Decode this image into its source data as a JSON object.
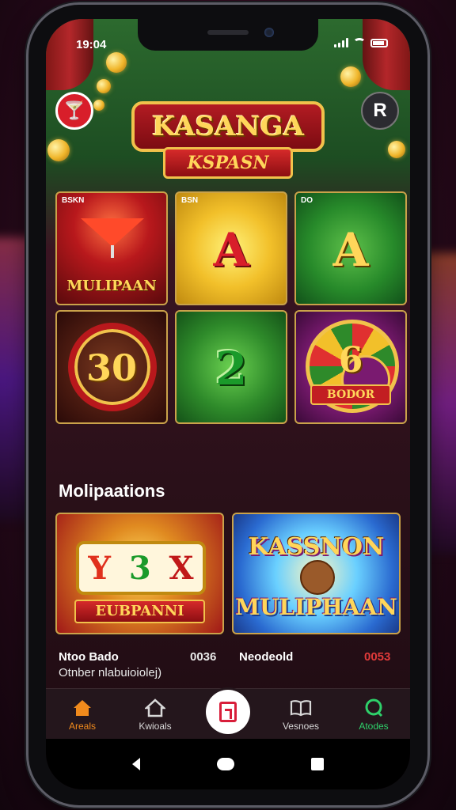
{
  "status_bar": {
    "time": "19:04"
  },
  "header": {
    "logo_title": "KASANGA",
    "logo_subtitle": "KSPASN",
    "right_button_glyph": "R",
    "left_button_icon": "cocktail-icon",
    "right_button_icon": "profile-icon"
  },
  "games": [
    {
      "tag": "BSKN",
      "big": "",
      "caption": "MULIPAAN",
      "theme": "cocktail"
    },
    {
      "tag": "BSN",
      "big": "A",
      "caption": "",
      "theme": "gold-letter"
    },
    {
      "tag": "DO",
      "big": "A",
      "caption": "",
      "theme": "green-letter"
    },
    {
      "tag": "",
      "big": "30",
      "caption": "",
      "theme": "ring"
    },
    {
      "tag": "",
      "big": "2",
      "caption": "",
      "theme": "green-number"
    },
    {
      "tag": "",
      "big": "6",
      "caption": "BODOR",
      "theme": "wheel"
    }
  ],
  "section": {
    "title": "Molipaations"
  },
  "promos": [
    {
      "reels": [
        "Y",
        "3",
        "X"
      ],
      "ribbon": "EUBPANNI"
    },
    {
      "title": "KASSNON",
      "title2": "MULIPHAAN"
    }
  ],
  "info": {
    "left_name": "Ntoo Bado",
    "left_num": "0036",
    "right_name": "Neodeold",
    "right_num": "0053",
    "sub": "Otnber nlabuioiolej)"
  },
  "nav": {
    "items": [
      {
        "label": "Areals",
        "icon": "home-icon"
      },
      {
        "label": "Kwioals",
        "icon": "house-icon"
      },
      {
        "label": "",
        "icon": "center-app-icon"
      },
      {
        "label": "Vesnoes",
        "icon": "book-icon"
      },
      {
        "label": "Atodes",
        "icon": "chat-icon"
      }
    ]
  },
  "colors": {
    "accent_orange": "#f08a1c",
    "accent_green": "#2ed06a",
    "accent_red": "#d81e2a",
    "gold": "#f1c24b"
  }
}
